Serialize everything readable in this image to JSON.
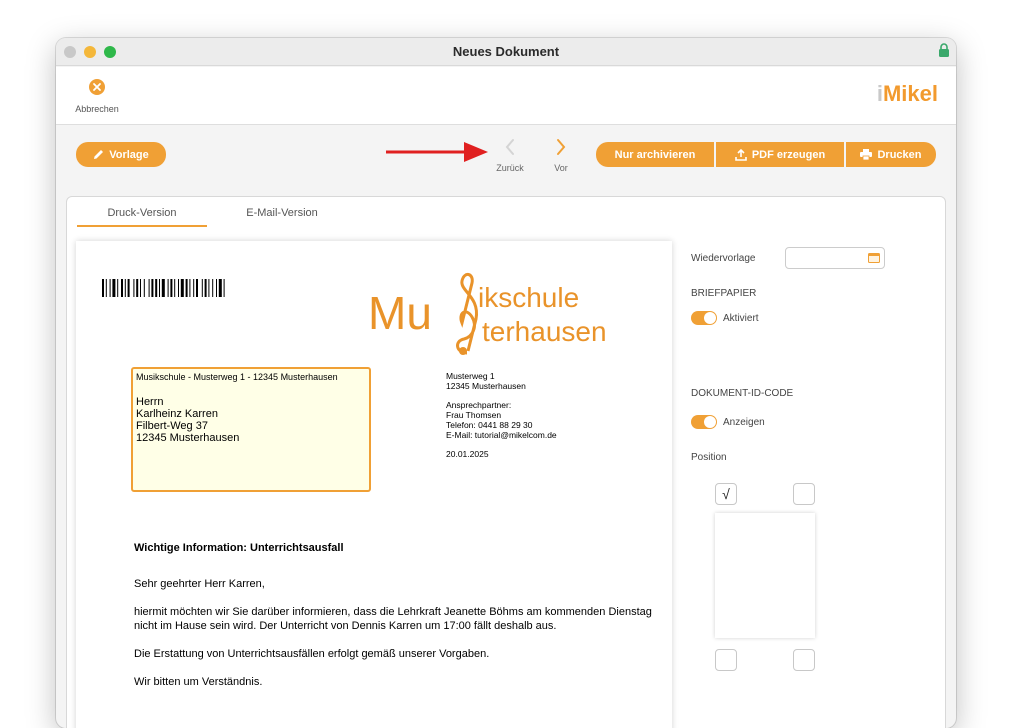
{
  "window": {
    "title": "Neues Dokument"
  },
  "toolbar": {
    "cancel_label": "Abbrechen",
    "logo_i": "i",
    "logo_rest": "Mikel"
  },
  "actions": {
    "vorlage": "Vorlage",
    "back": "Zurück",
    "forward": "Vor",
    "archive": "Nur archivieren",
    "pdf": "PDF erzeugen",
    "print": "Drucken"
  },
  "tabs": {
    "print": "Druck-Version",
    "mail": "E-Mail-Version"
  },
  "letter": {
    "brand_line1": "ikschule",
    "brand_line2": "terhausen",
    "brand_mu": "Mu",
    "sender_line": "Musikschule - Musterweg 1 - 12345 Musterhausen",
    "recipient": [
      "Herrn",
      "Karlheinz Karren",
      "Filbert-Weg 37",
      "12345 Musterhausen"
    ],
    "info": {
      "street": "Musterweg 1",
      "city": "12345 Musterhausen",
      "contact_label": "Ansprechpartner:",
      "contact_name": "Frau Thomsen",
      "phone": "Telefon: 0441 88 29 30",
      "email": "E-Mail: tutorial@mikelcom.de",
      "date": "20.01.2025"
    },
    "subject": "Wichtige Information: Unterrichtsausfall",
    "salutation": "Sehr geehrter Herr Karren,",
    "body1": "hiermit möchten wir Sie darüber informieren, dass die Lehrkraft Jeanette Böhms am kommenden Dienstag nicht im Hause sein wird. Der Unterricht von Dennis Karren um 17:00 fällt deshalb aus.",
    "body2": "Die Erstattung von Unterrichtsausfällen erfolgt gemäß unserer Vorgaben.",
    "body3": "Wir bitten um Verständnis."
  },
  "sidebar": {
    "wiedervorlage_label": "Wiedervorlage",
    "wiedervorlage_value": "",
    "briefpapier_heading": "BRIEFPAPIER",
    "briefpapier_toggle": "Aktiviert",
    "docid_heading": "DOKUMENT-ID-CODE",
    "docid_toggle": "Anzeigen",
    "position_label": "Position",
    "position_check": "√"
  },
  "colors": {
    "accent": "#f0a035",
    "annotation_arrow": "#e02020"
  }
}
